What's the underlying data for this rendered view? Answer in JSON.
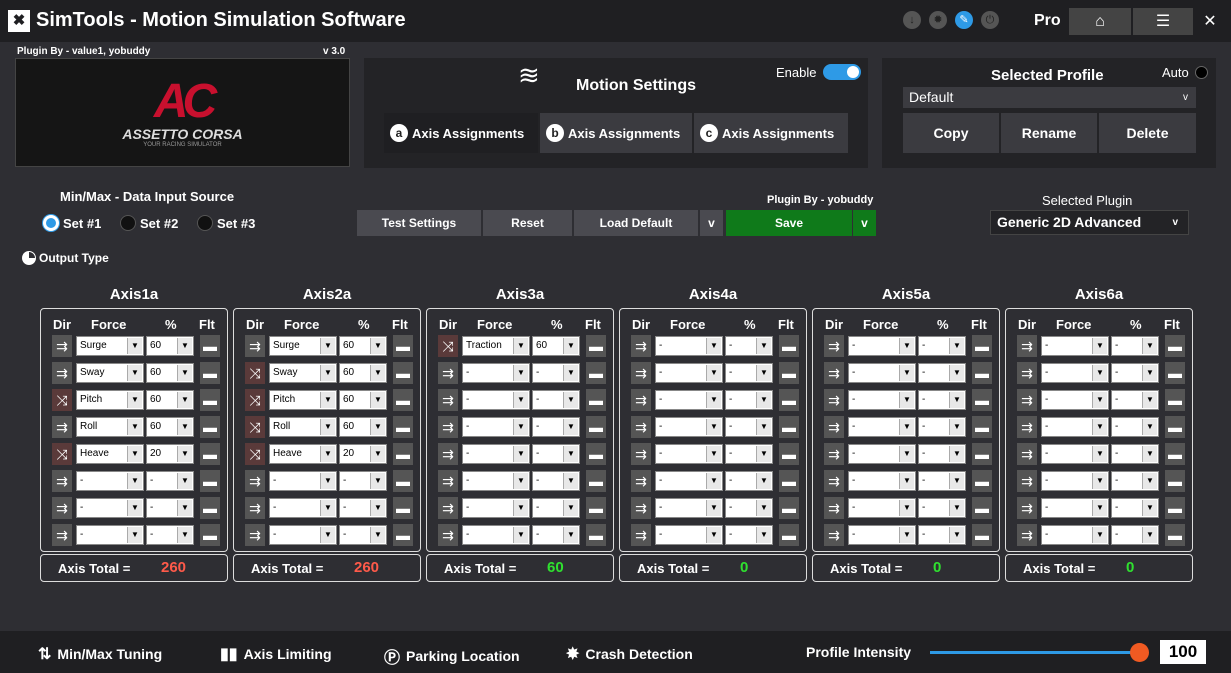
{
  "app": {
    "logo": "✖",
    "title": "SimTools - Motion Simulation Software",
    "edition": "Pro"
  },
  "titlebar": {
    "icons": [
      "↓",
      "✹",
      "✎",
      "⏻"
    ],
    "home_icon": "⌂",
    "menu_icon": "☰",
    "close_icon": "✕"
  },
  "plugin_info": {
    "by": "Plugin By - value1, yobuddy",
    "version": "v 3.0",
    "banner_logo": "AC",
    "banner_name": "ASSETTO CORSA",
    "banner_tag": "YOUR RACING SIMULATOR"
  },
  "motion": {
    "wave_icon": "≋",
    "title": "Motion Settings",
    "enable_label": "Enable",
    "enabled": true,
    "tabs": [
      {
        "letter": "a",
        "label": "Axis Assignments"
      },
      {
        "letter": "b",
        "label": "Axis Assignments"
      },
      {
        "letter": "c",
        "label": "Axis Assignments"
      }
    ]
  },
  "profile": {
    "title": "Selected Profile",
    "auto_label": "Auto",
    "selected": "Default",
    "chevron": "v",
    "buttons": [
      "Copy",
      "Rename",
      "Delete"
    ]
  },
  "input_source": {
    "label": "Min/Max - Data Input Source",
    "sets": [
      "Set #1",
      "Set #2",
      "Set #3"
    ],
    "selected": "Set #1"
  },
  "actions": {
    "test": "Test Settings",
    "reset": "Reset",
    "load_default": "Load Default",
    "dd": "v",
    "plugin_by": "Plugin By - yobuddy",
    "save": "Save"
  },
  "selected_plugin": {
    "label": "Selected Plugin",
    "value": "Generic 2D Advanced",
    "chevron": "v"
  },
  "output_type": "Output Type",
  "headers": {
    "dir": "Dir",
    "force": "Force",
    "pct": "%",
    "flt": "Flt",
    "total": "Axis Total =",
    "dd": "▼",
    "arrow": "⇉",
    "reverse": "⤨",
    "flt_mark": "▬"
  },
  "axes": [
    {
      "name": "Axis1a",
      "total": "260",
      "total_color": "#ff5a4a",
      "rows": [
        {
          "force": "Surge",
          "pct": "60",
          "rev": false
        },
        {
          "force": "Sway",
          "pct": "60",
          "rev": false
        },
        {
          "force": "Pitch",
          "pct": "60",
          "rev": true
        },
        {
          "force": "Roll",
          "pct": "60",
          "rev": false
        },
        {
          "force": "Heave",
          "pct": "20",
          "rev": true
        },
        {
          "force": "-",
          "pct": "-",
          "rev": false
        },
        {
          "force": "-",
          "pct": "-",
          "rev": false
        },
        {
          "force": "-",
          "pct": "-",
          "rev": false
        }
      ]
    },
    {
      "name": "Axis2a",
      "total": "260",
      "total_color": "#ff5a4a",
      "rows": [
        {
          "force": "Surge",
          "pct": "60",
          "rev": false
        },
        {
          "force": "Sway",
          "pct": "60",
          "rev": true
        },
        {
          "force": "Pitch",
          "pct": "60",
          "rev": true
        },
        {
          "force": "Roll",
          "pct": "60",
          "rev": true
        },
        {
          "force": "Heave",
          "pct": "20",
          "rev": true
        },
        {
          "force": "-",
          "pct": "-",
          "rev": false
        },
        {
          "force": "-",
          "pct": "-",
          "rev": false
        },
        {
          "force": "-",
          "pct": "-",
          "rev": false
        }
      ]
    },
    {
      "name": "Axis3a",
      "total": "60",
      "total_color": "#2fe02f",
      "rows": [
        {
          "force": "Traction",
          "pct": "60",
          "rev": true
        },
        {
          "force": "-",
          "pct": "-",
          "rev": false
        },
        {
          "force": "-",
          "pct": "-",
          "rev": false
        },
        {
          "force": "-",
          "pct": "-",
          "rev": false
        },
        {
          "force": "-",
          "pct": "-",
          "rev": false
        },
        {
          "force": "-",
          "pct": "-",
          "rev": false
        },
        {
          "force": "-",
          "pct": "-",
          "rev": false
        },
        {
          "force": "-",
          "pct": "-",
          "rev": false
        }
      ]
    },
    {
      "name": "Axis4a",
      "total": "0",
      "total_color": "#2fe02f",
      "rows": [
        {
          "force": "-",
          "pct": "-",
          "rev": false
        },
        {
          "force": "-",
          "pct": "-",
          "rev": false
        },
        {
          "force": "-",
          "pct": "-",
          "rev": false
        },
        {
          "force": "-",
          "pct": "-",
          "rev": false
        },
        {
          "force": "-",
          "pct": "-",
          "rev": false
        },
        {
          "force": "-",
          "pct": "-",
          "rev": false
        },
        {
          "force": "-",
          "pct": "-",
          "rev": false
        },
        {
          "force": "-",
          "pct": "-",
          "rev": false
        }
      ]
    },
    {
      "name": "Axis5a",
      "total": "0",
      "total_color": "#2fe02f",
      "rows": [
        {
          "force": "-",
          "pct": "-",
          "rev": false
        },
        {
          "force": "-",
          "pct": "-",
          "rev": false
        },
        {
          "force": "-",
          "pct": "-",
          "rev": false
        },
        {
          "force": "-",
          "pct": "-",
          "rev": false
        },
        {
          "force": "-",
          "pct": "-",
          "rev": false
        },
        {
          "force": "-",
          "pct": "-",
          "rev": false
        },
        {
          "force": "-",
          "pct": "-",
          "rev": false
        },
        {
          "force": "-",
          "pct": "-",
          "rev": false
        }
      ]
    },
    {
      "name": "Axis6a",
      "total": "0",
      "total_color": "#2fe02f",
      "rows": [
        {
          "force": "-",
          "pct": "-",
          "rev": false
        },
        {
          "force": "-",
          "pct": "-",
          "rev": false
        },
        {
          "force": "-",
          "pct": "-",
          "rev": false
        },
        {
          "force": "-",
          "pct": "-",
          "rev": false
        },
        {
          "force": "-",
          "pct": "-",
          "rev": false
        },
        {
          "force": "-",
          "pct": "-",
          "rev": false
        },
        {
          "force": "-",
          "pct": "-",
          "rev": false
        },
        {
          "force": "-",
          "pct": "-",
          "rev": false
        }
      ]
    }
  ],
  "bottom": {
    "items": [
      {
        "icon": "⇅",
        "label": "Min/Max Tuning"
      },
      {
        "icon": "▮▮",
        "label": "Axis Limiting"
      },
      {
        "icon": "Ⓟ",
        "label": "Parking Location"
      },
      {
        "icon": "✸",
        "label": "Crash Detection"
      }
    ],
    "intensity_label": "Profile Intensity",
    "intensity_value": "100"
  }
}
